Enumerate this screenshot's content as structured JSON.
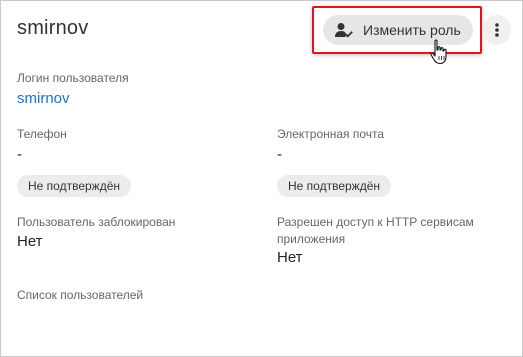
{
  "header": {
    "title": "smirnov",
    "change_role_label": "Изменить роль"
  },
  "fields": {
    "login": {
      "label": "Логин пользователя",
      "value": "smirnov"
    },
    "phone": {
      "label": "Телефон",
      "value": "-",
      "status": "Не подтверждён"
    },
    "email": {
      "label": "Электронная почта",
      "value": "-",
      "status": "Не подтверждён"
    },
    "blocked": {
      "label": "Пользователь заблокирован",
      "value": "Нет"
    },
    "http_access": {
      "label_line1": "Разрешен доступ к HTTP сервисам",
      "label_line2": "приложения",
      "value": "Нет"
    },
    "user_list": {
      "label": "Список пользователей"
    }
  },
  "icons": {
    "change_role": "user-check-icon",
    "more": "more-vertical-icon",
    "cursor": "hand-pointer-icon"
  },
  "colors": {
    "link": "#1a73c8",
    "highlight": "#e0151b"
  }
}
